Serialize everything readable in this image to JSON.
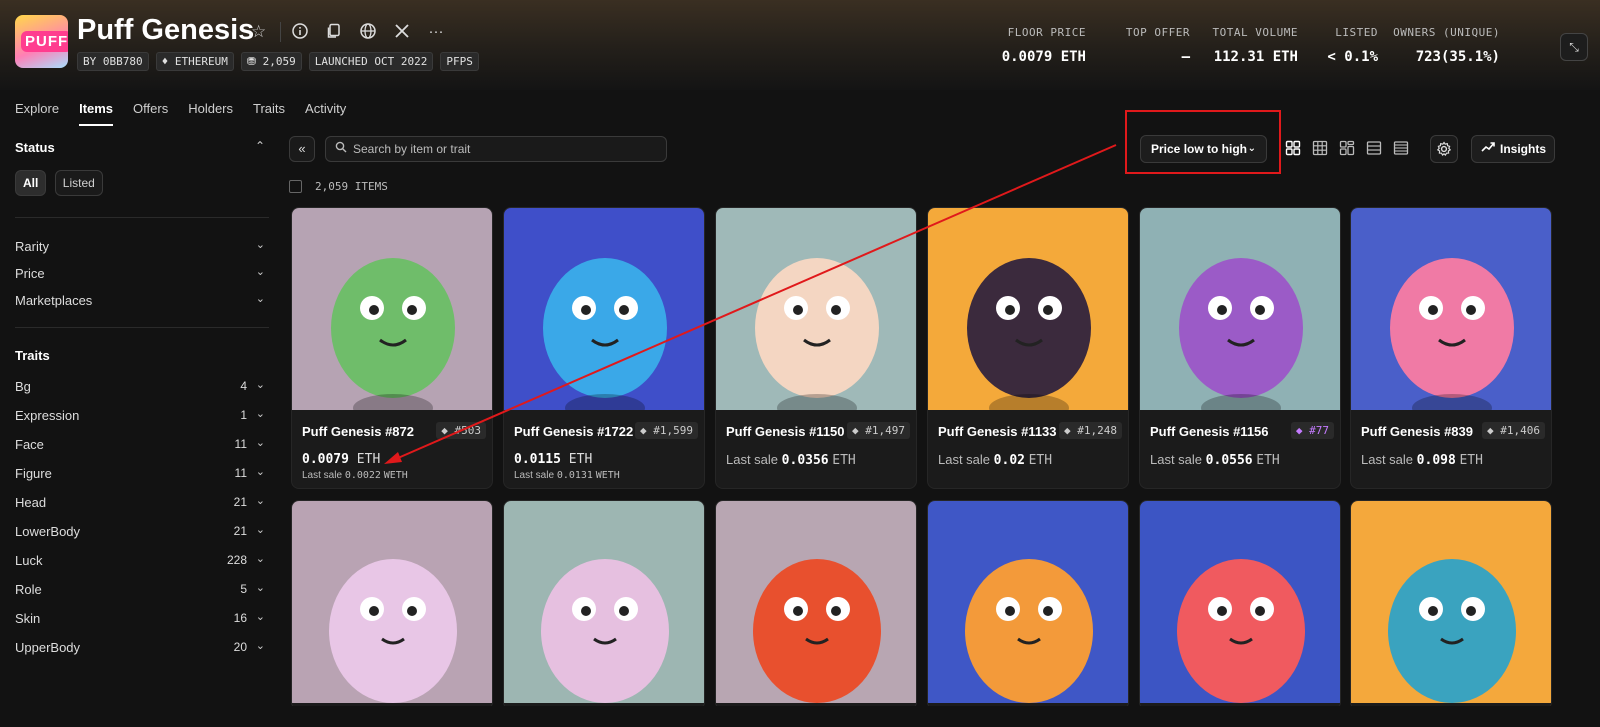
{
  "collection": {
    "logo_text": "PUFF",
    "title": "Puff Genesis",
    "tags": [
      "BY 0BB780",
      "♦ ETHEREUM",
      "⛃ 2,059",
      "LAUNCHED OCT 2022",
      "PFPS"
    ],
    "header_icons": [
      "star-icon",
      "info-icon",
      "copy-icon",
      "globe-icon",
      "x-icon",
      "more-icon"
    ]
  },
  "stats": [
    {
      "label": "FLOOR PRICE",
      "value": "0.0079 ETH"
    },
    {
      "label": "TOP OFFER",
      "value": "–"
    },
    {
      "label": "TOTAL VOLUME",
      "value": "112.31 ETH"
    },
    {
      "label": "LISTED",
      "value": "< 0.1%"
    },
    {
      "label": "OWNERS (UNIQUE)",
      "value": "723(35.1%)"
    }
  ],
  "tabs": [
    "Explore",
    "Items",
    "Offers",
    "Holders",
    "Traits",
    "Activity"
  ],
  "active_tab": "Items",
  "sidebar": {
    "status_title": "Status",
    "status_pills": [
      "All",
      "Listed"
    ],
    "filters": [
      "Rarity",
      "Price",
      "Marketplaces"
    ],
    "traits_title": "Traits",
    "traits": [
      {
        "name": "Bg",
        "count": "4"
      },
      {
        "name": "Expression",
        "count": "1"
      },
      {
        "name": "Face",
        "count": "11"
      },
      {
        "name": "Figure",
        "count": "11"
      },
      {
        "name": "Head",
        "count": "21"
      },
      {
        "name": "LowerBody",
        "count": "21"
      },
      {
        "name": "Luck",
        "count": "228"
      },
      {
        "name": "Role",
        "count": "5"
      },
      {
        "name": "Skin",
        "count": "16"
      },
      {
        "name": "UpperBody",
        "count": "20"
      }
    ]
  },
  "toolbar": {
    "search_placeholder": "Search by item or trait",
    "sort_label": "Price low to high",
    "insights_label": "Insights",
    "items_count": "2,059 ITEMS"
  },
  "items": [
    {
      "name": "Puff Genesis #872",
      "rank": "#503",
      "price": "0.0079",
      "currency": "ETH",
      "last_sale_prefix": "Last sale",
      "last_sale": "0.0022",
      "last_sale_currency": "WETH",
      "bg": "#b6a3b3",
      "body": "#6fbd6a",
      "epic": false
    },
    {
      "name": "Puff Genesis #1722",
      "rank": "#1,599",
      "price": "0.0115",
      "currency": "ETH",
      "last_sale_prefix": "Last sale",
      "last_sale": "0.0131",
      "last_sale_currency": "WETH",
      "bg": "#3f4fc9",
      "body": "#3aa8e8",
      "epic": false
    },
    {
      "name": "Puff Genesis #1150",
      "rank": "#1,497",
      "last_sale_prefix": "Last sale",
      "last_sale": "0.0356",
      "last_sale_currency": "ETH",
      "bg": "#9fb9b8",
      "body": "#f4d6c2",
      "epic": false
    },
    {
      "name": "Puff Genesis #1133",
      "rank": "#1,248",
      "last_sale_prefix": "Last sale",
      "last_sale": "0.02",
      "last_sale_currency": "ETH",
      "bg": "#f4a93a",
      "body": "#3b2a3d",
      "epic": false
    },
    {
      "name": "Puff Genesis #1156",
      "rank": "#77",
      "last_sale_prefix": "Last sale",
      "last_sale": "0.0556",
      "last_sale_currency": "ETH",
      "bg": "#8fb1b4",
      "body": "#9b5bc7",
      "epic": true
    },
    {
      "name": "Puff Genesis #839",
      "rank": "#1,406",
      "last_sale_prefix": "Last sale",
      "last_sale": "0.098",
      "last_sale_currency": "ETH",
      "bg": "#4a5fc9",
      "body": "#f07aa5",
      "epic": false
    }
  ],
  "items_row2": [
    {
      "bg": "#b9a3b3",
      "body": "#e8c6e6"
    },
    {
      "bg": "#9db6b2",
      "body": "#e6c0e0"
    },
    {
      "bg": "#b8a6b2",
      "body": "#e8502e"
    },
    {
      "bg": "#3f57c6",
      "body": "#f39a3a"
    },
    {
      "bg": "#3c55c4",
      "body": "#f05a5f"
    },
    {
      "bg": "#f4a83c",
      "body": "#3aa3bf"
    }
  ]
}
